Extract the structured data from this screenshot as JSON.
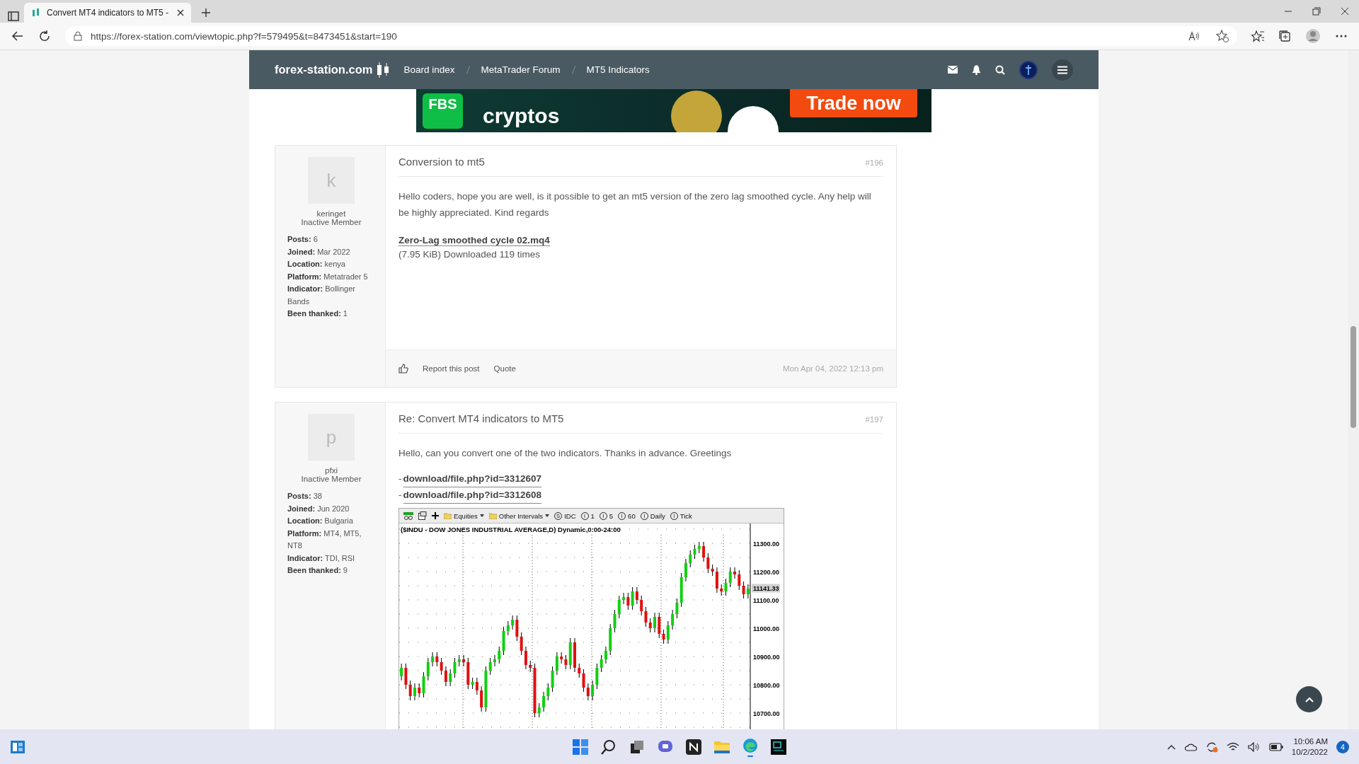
{
  "browser": {
    "tab": {
      "title": "Convert MT4 indicators to MT5 -",
      "selected": true
    },
    "url": "https://forex-station.com/viewtopic.php?f=579495&t=8473451&start=190"
  },
  "site": {
    "logo": "forex-station.com",
    "breadcrumbs": [
      "Board index",
      "MetaTrader Forum",
      "MT5 Indicators"
    ]
  },
  "ad": {
    "brand": "FBS",
    "headline": "cryptos",
    "cta": "Trade now"
  },
  "posts": [
    {
      "author": {
        "initial": "k",
        "name": "keringet",
        "rank": "Inactive Member",
        "stats": [
          {
            "label": "Posts:",
            "value": "6"
          },
          {
            "label": "Joined:",
            "value": "Mar 2022"
          },
          {
            "label": "Location:",
            "value": "kenya"
          },
          {
            "label": "Platform:",
            "value": "Metatrader 5"
          },
          {
            "label": "Indicator:",
            "value": "Bollinger Bands"
          },
          {
            "label": "Been thanked:",
            "value": "1"
          }
        ]
      },
      "title": "Conversion to mt5",
      "number": "#196",
      "paragraphs": [
        "Hello coders, hope you are well, is it possible to get an mt5 version of the zero lag smoothed cycle. Any help will be highly appreciated. Kind regards"
      ],
      "attachment": {
        "link": "Zero-Lag smoothed cycle 02.mq4",
        "info": "(7.95 KiB) Downloaded 119 times"
      },
      "actions": [
        "Report this post",
        "Quote"
      ],
      "date": "Mon Apr 04, 2022 12:13 pm"
    },
    {
      "author": {
        "initial": "p",
        "name": "pfxi",
        "rank": "Inactive Member",
        "stats": [
          {
            "label": "Posts:",
            "value": "38"
          },
          {
            "label": "Joined:",
            "value": "Jun 2020"
          },
          {
            "label": "Location:",
            "value": "Bulgaria"
          },
          {
            "label": "Platform:",
            "value": "MT4, MT5, NT8"
          },
          {
            "label": "Indicator:",
            "value": "TDI, RSI"
          },
          {
            "label": "Been thanked:",
            "value": "9"
          }
        ]
      },
      "title": "Re: Convert MT4 indicators to MT5",
      "number": "#197",
      "paragraphs": [
        "Hello, can you convert one of the two indicators. Thanks in advance. Greetings"
      ],
      "links": [
        {
          "prefix": "-",
          "text": "download/file.php?id=3312607"
        },
        {
          "prefix": "-",
          "text": "download/file.php?id=3312608"
        }
      ],
      "image": {
        "toolbar": [
          {
            "kind": "folder",
            "label": "Equities"
          },
          {
            "kind": "folder",
            "label": "Other Intervals"
          },
          {
            "kind": "interval",
            "badge": "S",
            "label": "IDC"
          },
          {
            "kind": "interval",
            "badge": "I",
            "label": "1"
          },
          {
            "kind": "interval",
            "badge": "I",
            "label": "5"
          },
          {
            "kind": "interval",
            "badge": "I",
            "label": "60"
          },
          {
            "kind": "interval",
            "badge": "I",
            "label": "Daily"
          },
          {
            "kind": "interval",
            "badge": "I",
            "label": "Tick"
          }
        ],
        "chart_data": {
          "type": "candlestick",
          "grid": true,
          "ylim": [
            10620,
            11370
          ],
          "title": "($INDU - DOW JONES INDUSTRIAL AVERAGE,D) Dynamic,0:00-24:00",
          "yticks": [
            {
              "value": 11300,
              "label": "11300.00"
            },
            {
              "value": 11200,
              "label": "11200.00"
            },
            {
              "value": 11100,
              "label": "11100.00"
            },
            {
              "value": 11000,
              "label": "11000.00"
            },
            {
              "value": 10900,
              "label": "10900.00"
            },
            {
              "value": 10800,
              "label": "10800.00"
            },
            {
              "value": 10700,
              "label": "10700.00"
            }
          ],
          "ohlc": [
            [
              10830,
              10875,
              10815,
              10860
            ],
            [
              10860,
              10875,
              10785,
              10800
            ],
            [
              10800,
              10815,
              10745,
              10760
            ],
            [
              10760,
              10805,
              10745,
              10790
            ],
            [
              10790,
              10805,
              10755,
              10770
            ],
            [
              10770,
              10845,
              10755,
              10830
            ],
            [
              10830,
              10895,
              10815,
              10880
            ],
            [
              10880,
              10915,
              10865,
              10900
            ],
            [
              10900,
              10915,
              10865,
              10880
            ],
            [
              10880,
              10895,
              10835,
              10850
            ],
            [
              10850,
              10865,
              10795,
              10810
            ],
            [
              10810,
              10855,
              10795,
              10840
            ],
            [
              10840,
              10895,
              10825,
              10880
            ],
            [
              10880,
              10905,
              10865,
              10890
            ],
            [
              10890,
              10905,
              10865,
              10880
            ],
            [
              10880,
              10895,
              10785,
              10800
            ],
            [
              10800,
              10825,
              10785,
              10810
            ],
            [
              10810,
              10825,
              10765,
              10780
            ],
            [
              10780,
              10795,
              10705,
              10720
            ],
            [
              10720,
              10865,
              10705,
              10850
            ],
            [
              10850,
              10895,
              10835,
              10880
            ],
            [
              10880,
              10905,
              10865,
              10890
            ],
            [
              10890,
              10935,
              10875,
              10920
            ],
            [
              10920,
              11005,
              10905,
              10990
            ],
            [
              10990,
              11025,
              10975,
              11010
            ],
            [
              11010,
              11045,
              10995,
              11030
            ],
            [
              11030,
              11045,
              10955,
              10970
            ],
            [
              10970,
              10985,
              10905,
              10920
            ],
            [
              10920,
              10935,
              10855,
              10870
            ],
            [
              10870,
              10885,
              10845,
              10860
            ],
            [
              10860,
              10875,
              10685,
              10700
            ],
            [
              10700,
              10735,
              10685,
              10720
            ],
            [
              10720,
              10775,
              10705,
              10760
            ],
            [
              10760,
              10805,
              10745,
              10790
            ],
            [
              10790,
              10865,
              10775,
              10850
            ],
            [
              10850,
              10915,
              10835,
              10900
            ],
            [
              10900,
              10915,
              10875,
              10890
            ],
            [
              10890,
              10905,
              10855,
              10870
            ],
            [
              10870,
              10965,
              10855,
              10950
            ],
            [
              10950,
              10965,
              10845,
              10860
            ],
            [
              10860,
              10875,
              10825,
              10840
            ],
            [
              10840,
              10855,
              10775,
              10790
            ],
            [
              10790,
              10805,
              10745,
              10760
            ],
            [
              10760,
              10815,
              10745,
              10800
            ],
            [
              10800,
              10875,
              10785,
              10860
            ],
            [
              10860,
              10905,
              10845,
              10890
            ],
            [
              10890,
              10935,
              10875,
              10920
            ],
            [
              10920,
              11015,
              10905,
              11000
            ],
            [
              11000,
              11065,
              10985,
              11050
            ],
            [
              11050,
              11115,
              11035,
              11100
            ],
            [
              11100,
              11125,
              11085,
              11110
            ],
            [
              11110,
              11125,
              11065,
              11080
            ],
            [
              11080,
              11145,
              11065,
              11130
            ],
            [
              11130,
              11145,
              11085,
              11100
            ],
            [
              11100,
              11115,
              11045,
              11060
            ],
            [
              11060,
              11075,
              11005,
              11020
            ],
            [
              11020,
              11035,
              10985,
              11000
            ],
            [
              11000,
              11055,
              10985,
              11040
            ],
            [
              11040,
              11055,
              10965,
              10980
            ],
            [
              10980,
              10995,
              10945,
              10960
            ],
            [
              10960,
              11025,
              10945,
              11010
            ],
            [
              11010,
              11065,
              10995,
              11050
            ],
            [
              11050,
              11105,
              11035,
              11090
            ],
            [
              11090,
              11195,
              11075,
              11180
            ],
            [
              11180,
              11245,
              11165,
              11230
            ],
            [
              11230,
              11275,
              11215,
              11260
            ],
            [
              11260,
              11295,
              11245,
              11280
            ],
            [
              11280,
              11305,
              11265,
              11290
            ],
            [
              11290,
              11305,
              11235,
              11250
            ],
            [
              11250,
              11265,
              11195,
              11210
            ],
            [
              11210,
              11225,
              11185,
              11200
            ],
            [
              11200,
              11215,
              11125,
              11140
            ],
            [
              11140,
              11155,
              11115,
              11130
            ],
            [
              11130,
              11175,
              11115,
              11160
            ],
            [
              11160,
              11215,
              11145,
              11200
            ],
            [
              11200,
              11215,
              11175,
              11190
            ],
            [
              11190,
              11205,
              11135,
              11150
            ],
            [
              11150,
              11165,
              11105,
              11120
            ],
            [
              11120,
              11155,
              11105,
              11140
            ]
          ]
        },
        "last_price": "11141.33"
      }
    }
  ],
  "taskbar": {
    "time": "10:06 AM",
    "date": "10/2/2022",
    "notifications": "4"
  }
}
